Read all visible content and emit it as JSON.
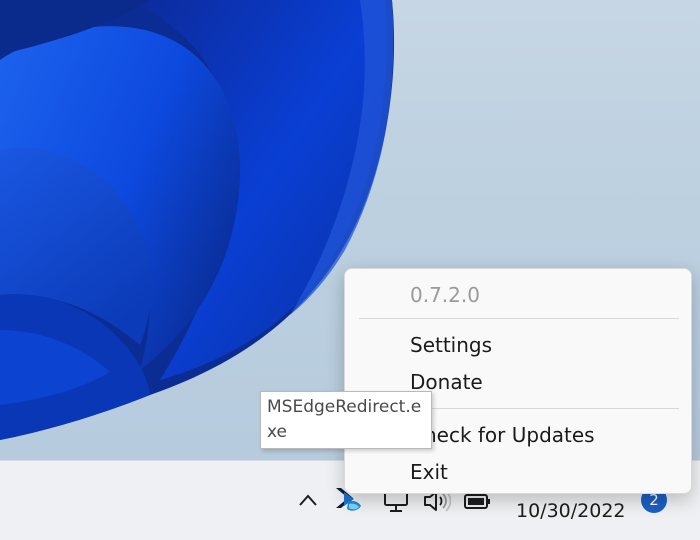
{
  "menu": {
    "version": "0.7.2.0",
    "items": [
      {
        "label": "Settings"
      },
      {
        "label": "Donate"
      },
      {
        "label": "Check for Updates"
      },
      {
        "label": "Exit"
      }
    ]
  },
  "tooltip": {
    "text": "MSEdgeRedirect.exe"
  },
  "taskbar": {
    "date": "10/30/2022",
    "notification_count": "2",
    "icons": [
      "chevron-up-icon",
      "msedgeredirect-app-icon",
      "network-icon",
      "volume-icon",
      "battery-icon"
    ]
  },
  "colors": {
    "accent": "#1c5fc4",
    "wallpaper_blue": "#0a3cc8",
    "taskbar": "#eef0f3",
    "menu_bg": "#f9f9f9"
  }
}
